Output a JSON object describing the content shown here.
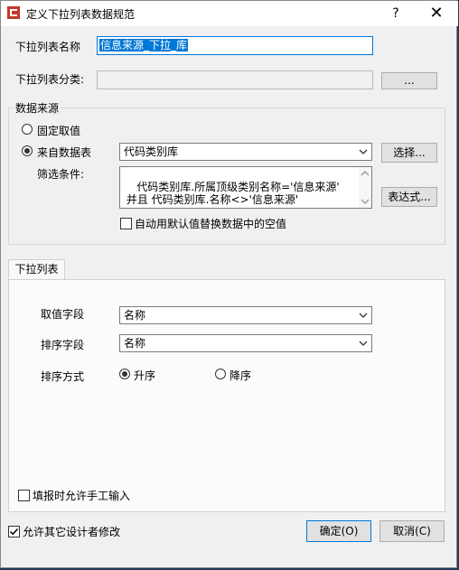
{
  "window": {
    "title": "定义下拉列表数据规范",
    "help": "?",
    "close": "✕"
  },
  "name_row": {
    "label": "下拉列表名称",
    "value": "信息来源_下拉_库"
  },
  "category_row": {
    "label": "下拉列表分类:",
    "value": "",
    "browse_label": "..."
  },
  "source_group": {
    "title": "数据来源",
    "fixed_label": "固定取值",
    "from_table_label": "来自数据表",
    "from_table_selected": true,
    "table_value": "代码类别库",
    "select_button": "选择...",
    "filter_label": "筛选条件:",
    "filter_text": "代码类别库.所属顶级类别名称='信息来源'\n 并且 代码类别库.名称<>'信息来源'",
    "expr_button": "表达式...",
    "default_check_label": "自动用默认值替换数据中的空值",
    "default_checked": false
  },
  "dropdown_tab": {
    "tab_label": "下拉列表",
    "value_field_label": "取值字段",
    "value_field": "名称",
    "sort_field_label": "排序字段",
    "sort_field": "名称",
    "sort_mode_label": "排序方式",
    "asc_label": "升序",
    "desc_label": "降序",
    "asc_selected": true,
    "manual_input_label": "填报时允许手工输入",
    "manual_input_checked": false
  },
  "footer": {
    "allow_modify_label": "允许其它设计者修改",
    "allow_modify_checked": true,
    "ok_button": "确定(O)",
    "cancel_button": "取消(C)"
  }
}
